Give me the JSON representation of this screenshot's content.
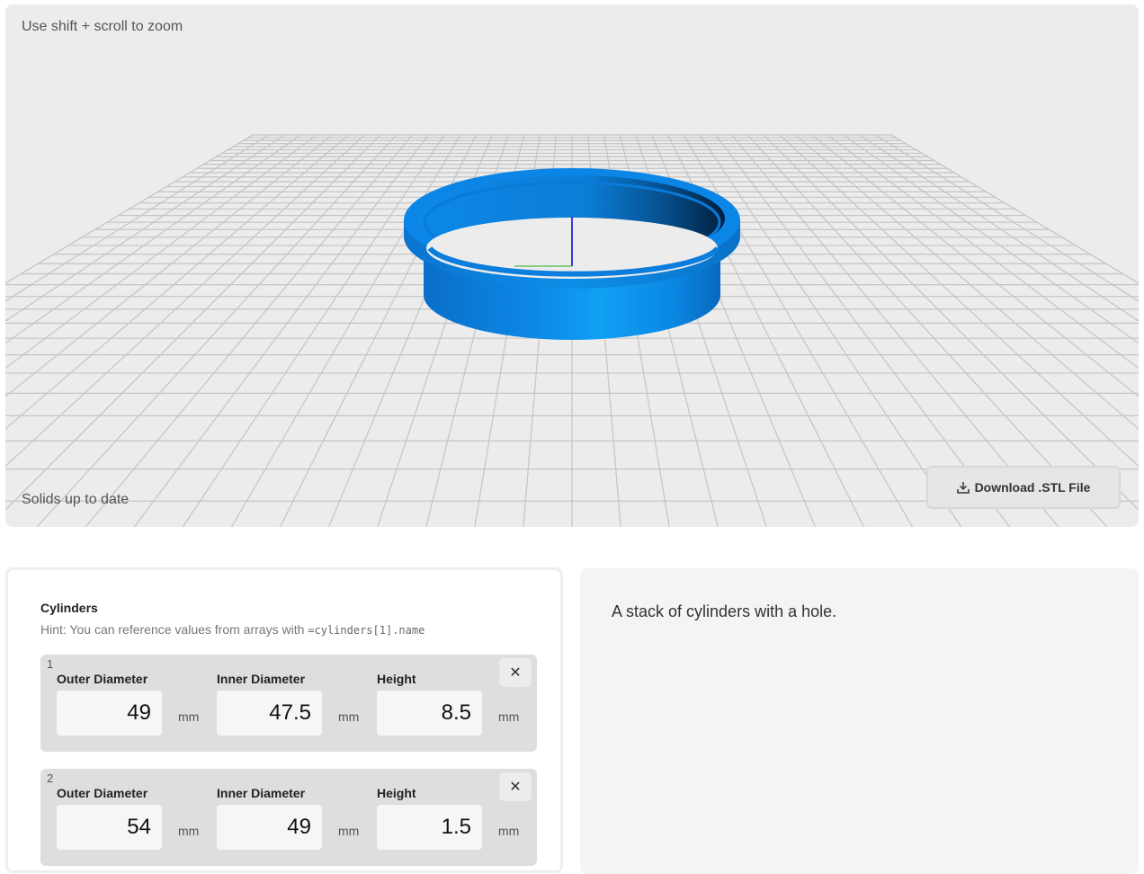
{
  "viewer": {
    "zoom_hint": "Use shift + scroll to zoom",
    "status": "Solids up to date",
    "download_label": "Download .STL File",
    "model_color": "#0a84e6",
    "grid_color": "#c4c4c4"
  },
  "params": {
    "section_title": "Cylinders",
    "hint_text": "Hint: You can reference values from arrays with ",
    "hint_code": "=cylinders[1].name",
    "cylinders": [
      {
        "index": "1",
        "remove": "✕",
        "outer_label": "Outer Diameter",
        "outer_value": "49",
        "outer_unit": "mm",
        "inner_label": "Inner Diameter",
        "inner_value": "47.5",
        "inner_unit": "mm",
        "height_label": "Height",
        "height_value": "8.5",
        "height_unit": "mm"
      },
      {
        "index": "2",
        "remove": "✕",
        "outer_label": "Outer Diameter",
        "outer_value": "54",
        "outer_unit": "mm",
        "inner_label": "Inner Diameter",
        "inner_value": "49",
        "inner_unit": "mm",
        "height_label": "Height",
        "height_value": "1.5",
        "height_unit": "mm"
      }
    ]
  },
  "description": {
    "text": "A stack of cylinders with a hole."
  }
}
